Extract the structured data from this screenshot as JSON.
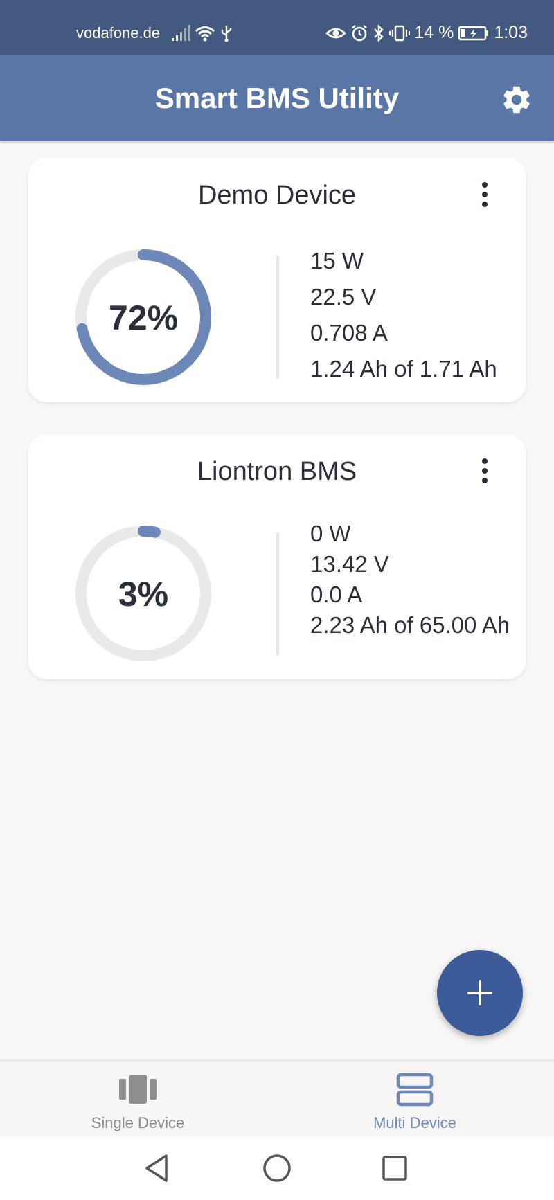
{
  "status_bar": {
    "carrier": "vodafone.de",
    "battery_percent": "14 %",
    "time": "1:03",
    "icons": [
      "signal-icon",
      "wifi-icon",
      "usb-icon",
      "eye-icon",
      "alarm-icon",
      "bluetooth-icon",
      "vibrate-icon",
      "battery-charging-icon"
    ]
  },
  "app_bar": {
    "title": "Smart BMS Utility",
    "settings_icon": "gear-icon"
  },
  "colors": {
    "app_bar": "#5976a6",
    "status_bar": "#44597f",
    "accent": "#6d88b8",
    "fab": "#3d5a99",
    "ring_track": "#e9e9e9"
  },
  "devices": [
    {
      "name": "Demo Device",
      "charge_percent": 72,
      "charge_label": "72%",
      "power": "15 W",
      "voltage": "22.5 V",
      "current": "0.708 A",
      "capacity": "1.24 Ah of 1.71 Ah"
    },
    {
      "name": "Liontron BMS",
      "charge_percent": 3,
      "charge_label": "3%",
      "power": "0 W",
      "voltage": "13.42 V",
      "current": "0.0 A",
      "capacity": "2.23 Ah of 65.00 Ah"
    }
  ],
  "fab": {
    "icon": "plus-icon"
  },
  "bottom_nav": {
    "items": [
      {
        "label": "Single Device",
        "icon": "battery-single-icon",
        "active": false
      },
      {
        "label": "Multi Device",
        "icon": "stacked-rows-icon",
        "active": true
      }
    ]
  },
  "system_nav": {
    "icons": [
      "back-icon",
      "home-icon",
      "recents-icon"
    ]
  }
}
